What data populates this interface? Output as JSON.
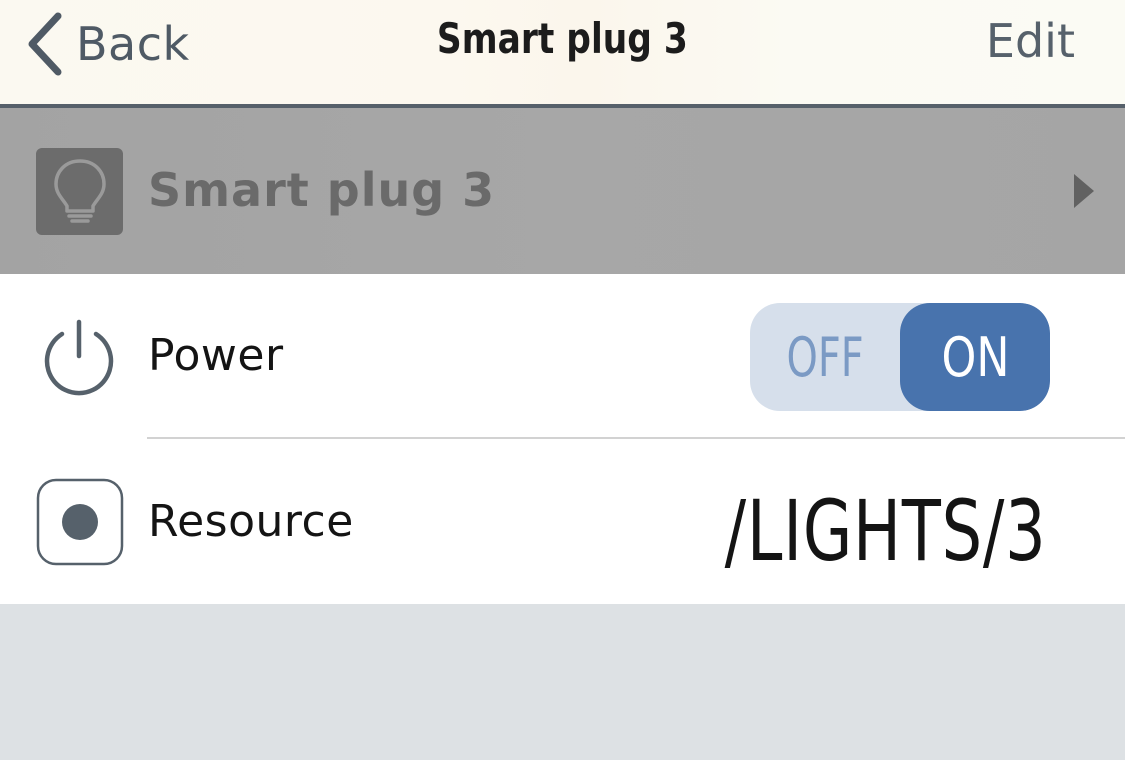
{
  "nav": {
    "back_label": "Back",
    "title": "Smart plug 3",
    "edit_label": "Edit"
  },
  "device": {
    "name": "Smart plug 3",
    "icon": "lightbulb-icon"
  },
  "rows": {
    "power": {
      "label": "Power",
      "icon": "power-icon",
      "toggle": {
        "off_label": "OFF",
        "on_label": "ON",
        "state": "on"
      }
    },
    "resource": {
      "label": "Resource",
      "icon": "resource-icon",
      "value": "/LIGHTS/3"
    }
  },
  "colors": {
    "accent": "#4873ad",
    "toggle_track": "#d6dfeb",
    "nav_text": "#4f5a65",
    "device_row_bg": "#a5a5a5",
    "page_bg": "#dde1e4"
  }
}
